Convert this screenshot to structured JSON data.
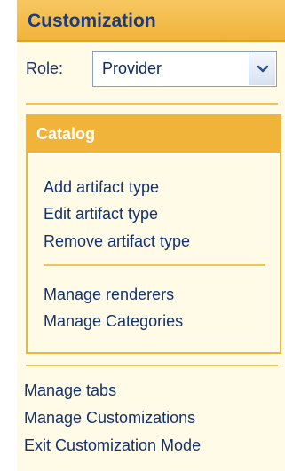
{
  "panel": {
    "title": "Customization",
    "role": {
      "label": "Role:",
      "selected": "Provider",
      "dropdown_icon": "chevron-down-icon"
    },
    "catalog": {
      "title": "Catalog",
      "groups": [
        {
          "items": [
            "Add artifact type",
            "Edit artifact type",
            "Remove artifact type"
          ]
        },
        {
          "items": [
            "Manage renderers",
            "Manage Categories"
          ]
        }
      ]
    },
    "bottom_links": [
      "Manage tabs",
      "Manage Customizations",
      "Exit Customization Mode"
    ]
  },
  "colors": {
    "header_bg": "#f0b43a",
    "panel_bg": "#fffbe6",
    "text": "#0b2a66"
  }
}
